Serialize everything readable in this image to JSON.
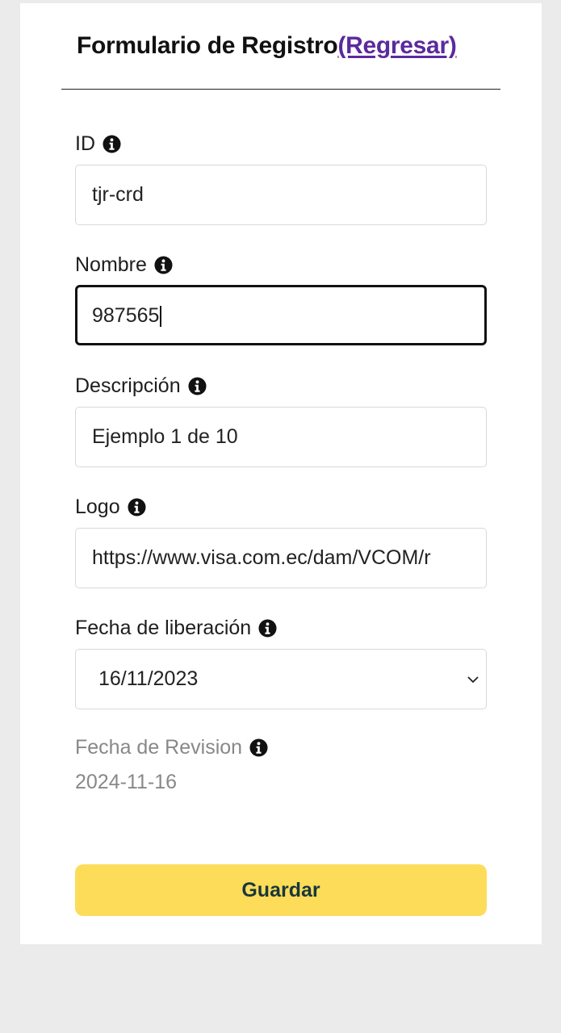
{
  "form": {
    "title": "Formulario de Registro",
    "back_link": "(Regresar)"
  },
  "fields": {
    "id": {
      "label": "ID",
      "value": "tjr-crd"
    },
    "nombre": {
      "label": "Nombre",
      "value": "987565"
    },
    "descripcion": {
      "label": "Descripción",
      "value": "Ejemplo 1 de 10"
    },
    "logo": {
      "label": "Logo",
      "value": "https://www.visa.com.ec/dam/VCOM/r"
    },
    "fecha_liberacion": {
      "label": "Fecha de liberación",
      "value": "16/11/2023"
    },
    "fecha_revision": {
      "label": "Fecha de Revision",
      "value": "2024-11-16"
    }
  },
  "actions": {
    "save_label": "Guardar"
  },
  "colors": {
    "background": "#ebebeb",
    "card": "#ffffff",
    "link": "#5b2a9e",
    "button": "#fddc5a",
    "button_text": "#18383a",
    "muted_text": "#888888"
  },
  "icons": [
    "info-icon",
    "chevron-down-icon"
  ]
}
